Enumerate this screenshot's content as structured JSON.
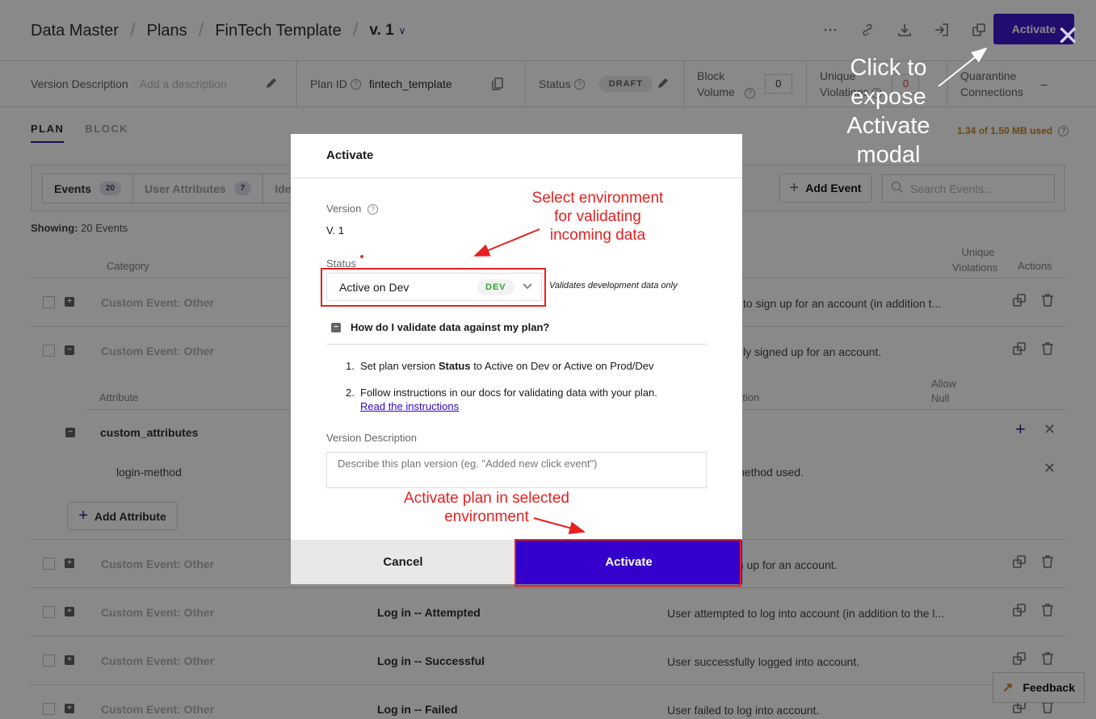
{
  "header": {
    "breadcrumbs": [
      "Data Master",
      "Plans",
      "FinTech Template"
    ],
    "version": "v. 1",
    "toolbar_icons": [
      "more-icon",
      "link-icon",
      "download-icon",
      "import-icon",
      "duplicate-icon"
    ],
    "activate_label": "Activate",
    "accent_color": "#2e06c8"
  },
  "infobar": {
    "version_description_label": "Version Description",
    "version_description_placeholder": "Add a description",
    "plan_id_label": "Plan ID",
    "plan_id_value": "fintech_template",
    "status_label": "Status",
    "status_value": "DRAFT",
    "block_volume_label_1": "Block",
    "block_volume_label_2": "Volume",
    "block_volume_value": "0",
    "unique_violations_label_1": "Unique",
    "unique_violations_label_2": "Violations",
    "unique_violations_value": "0",
    "quarantine_label_1": "Quarantine",
    "quarantine_label_2": "Connections",
    "quarantine_value": "–"
  },
  "tabs": [
    {
      "label": "PLAN",
      "active": true
    },
    {
      "label": "BLOCK",
      "active": false
    }
  ],
  "storage": "1.34 of 1.50 MB used",
  "segments": [
    {
      "label": "Events",
      "count": "20",
      "active": true
    },
    {
      "label": "User Attributes",
      "count": "7",
      "active": false
    },
    {
      "label": "Ide",
      "count": null,
      "active": false
    }
  ],
  "add_event_label": "Add Event",
  "search_placeholder": "Search Events...",
  "showing": {
    "label": "Showing:",
    "value": "20 Events"
  },
  "table": {
    "headers": {
      "category": "Category",
      "unique_violations_1": "Unique",
      "unique_violations_2": "Violations",
      "actions": "Actions"
    },
    "attr_headers": {
      "attribute": "Attribute",
      "description": "ption",
      "allow_null_1": "Allow",
      "allow_null_2": "Null"
    },
    "rows": [
      {
        "category": "Custom Event: Other",
        "name": "",
        "description": "to sign up for an account (in addition t...",
        "expanded": false
      },
      {
        "category": "Custom Event: Other",
        "name": "",
        "description": "ly signed up for an account.",
        "expanded": true
      },
      {
        "category": "Custom Event: Other",
        "name": "",
        "description": "gn up for an account.",
        "expanded": false
      },
      {
        "category": "Custom Event: Other",
        "name": "Log in -- Attempted",
        "description": "User attempted to log into account (in addition to the l...",
        "expanded": false
      },
      {
        "category": "Custom Event: Other",
        "name": "Log in -- Successful",
        "description": "User successfully logged into account.",
        "expanded": false
      },
      {
        "category": "Custom Event: Other",
        "name": "Log in -- Failed",
        "description": "User failed to log into account.",
        "expanded": false
      }
    ],
    "attributes": [
      {
        "name": "custom_attributes",
        "description": ""
      },
      {
        "name": "login-method",
        "description": "nethod used."
      }
    ],
    "add_attribute_label": "Add Attribute"
  },
  "feedback_label": "Feedback",
  "modal": {
    "title": "Activate",
    "version_label": "Version",
    "version_value": "V. 1",
    "status_label": "Status",
    "status_selected": "Active on Dev",
    "status_badge": "DEV",
    "status_hint": "Validates development data only",
    "faq_title": "How do I validate data against my plan?",
    "step1_prefix": "Set plan version ",
    "step1_bold": "Status",
    "step1_suffix": " to Active on Dev or Active on Prod/Dev",
    "step2_text": "Follow instructions in our docs for validating data with your plan.",
    "step2_link": "Read the instructions",
    "description_label": "Version Description",
    "description_placeholder": "Describe this plan version (eg. \"Added new click event\")",
    "cancel_label": "Cancel",
    "activate_label": "Activate",
    "activate_color": "#3300cc"
  },
  "annotations": {
    "top_right": [
      "Click to",
      "expose",
      "Activate",
      "modal"
    ],
    "select_env": [
      "Select environment",
      "for validating",
      "incoming data"
    ],
    "activate_plan": [
      "Activate plan in selected",
      "environment"
    ]
  }
}
